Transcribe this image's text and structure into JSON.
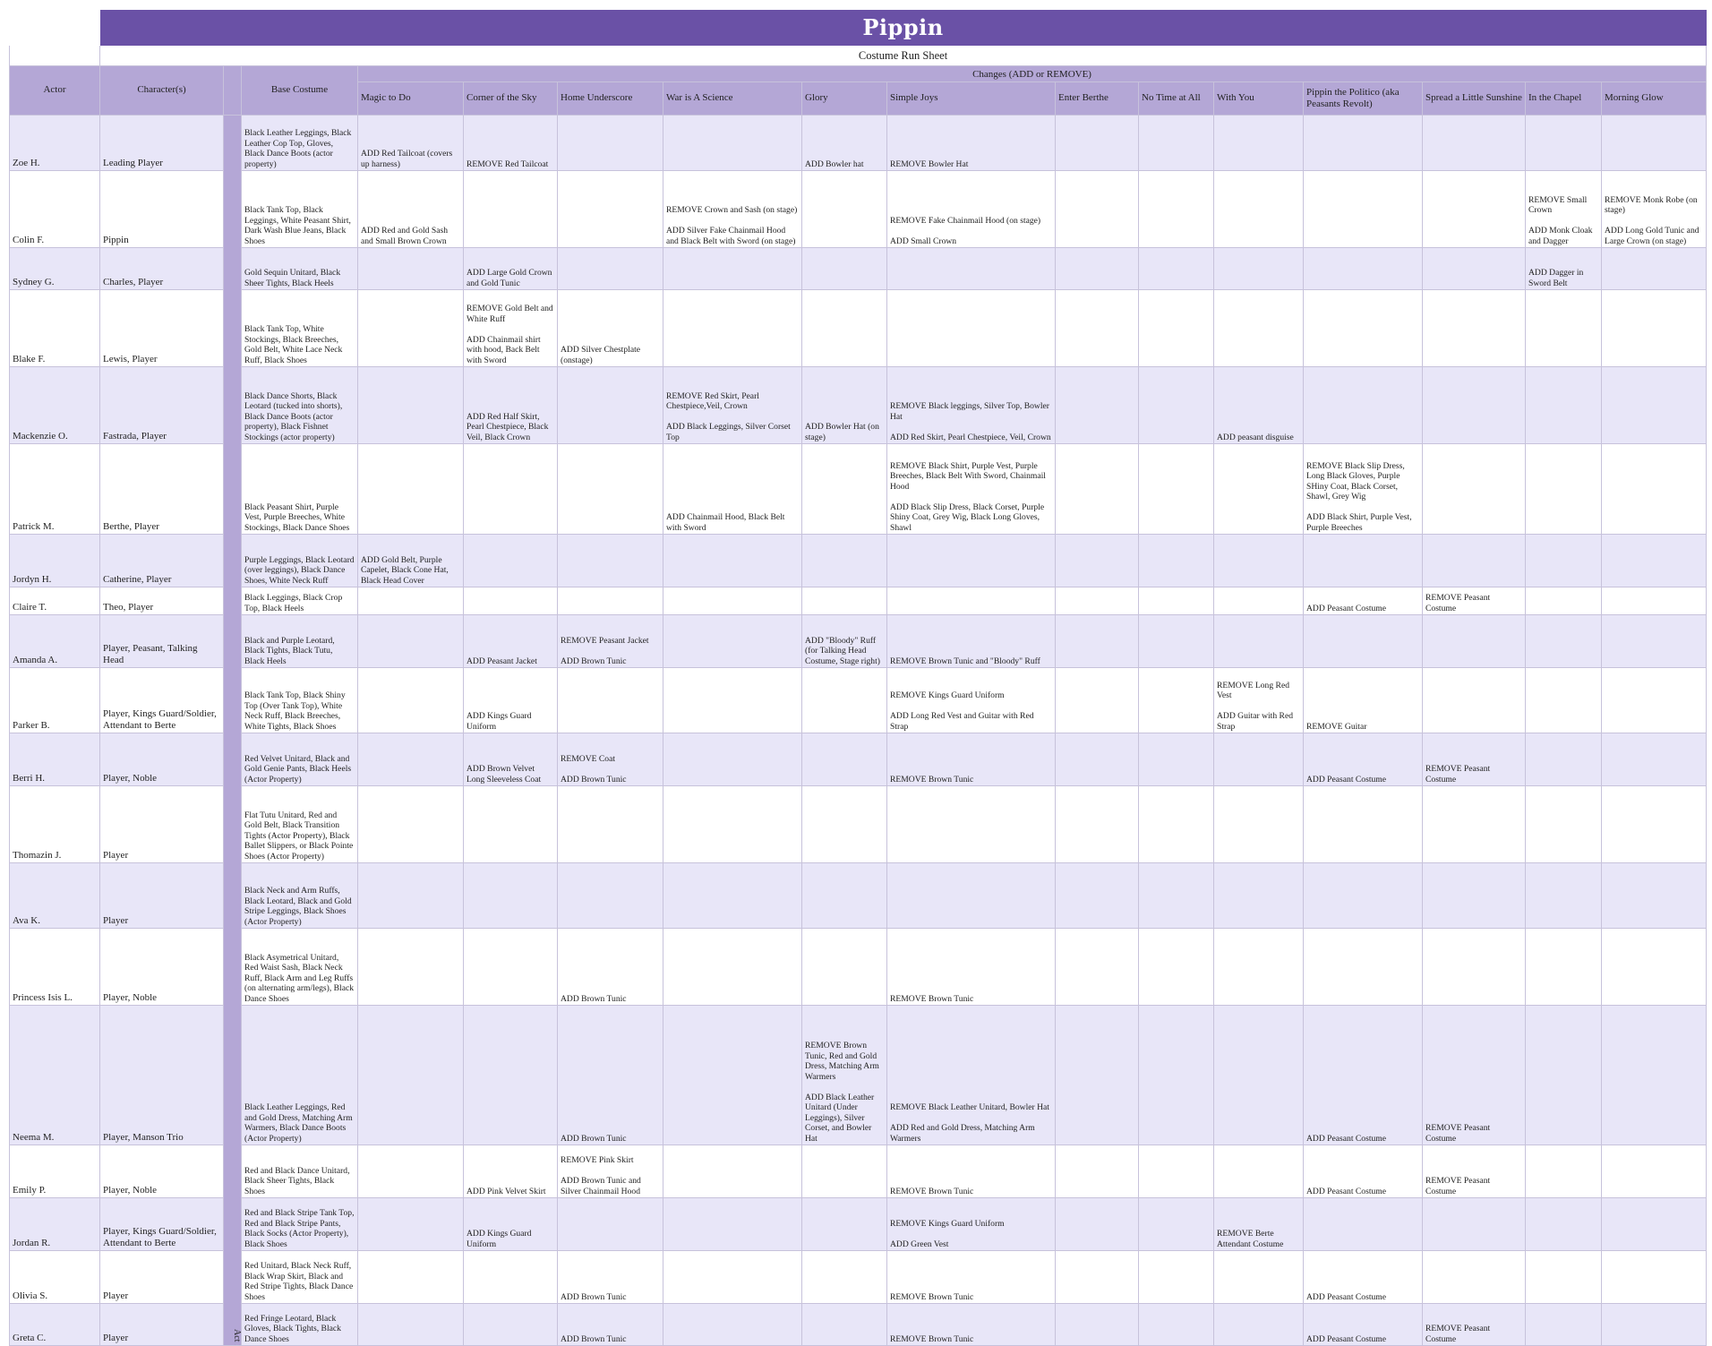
{
  "title": "Pippin",
  "subtitle": "Costume Run Sheet",
  "headers": {
    "actor": "Actor",
    "characters": "Character(s)",
    "base_costume": "Base Costume",
    "changes_group": "Changes (ADD or REMOVE)",
    "songs": [
      "Magic to Do",
      "Corner of the Sky",
      "Home Underscore",
      "War is A Science",
      "Glory",
      "Simple Joys",
      "Enter Berthe",
      "No Time at All",
      "With You",
      "Pippin the Politico (aka Peasants Revolt)",
      "Spread a Little Sunshine",
      "In the Chapel",
      "Morning Glow"
    ]
  },
  "act_label": "Act 1",
  "rows": [
    {
      "actor": "Zoe H.",
      "character": "Leading Player",
      "base": "Black Leather Leggings, Black Leather Cop Top, Gloves, Black Dance Boots (actor property)",
      "changes": [
        "ADD Red Tailcoat (covers up harness)",
        "REMOVE Red Tailcoat",
        "",
        "",
        "ADD Bowler hat",
        "REMOVE Bowler Hat",
        "",
        "",
        "",
        "",
        "",
        "",
        ""
      ]
    },
    {
      "actor": "Colin F.",
      "character": "Pippin",
      "base": "Black Tank Top, Black Leggings, White Peasant Shirt, Dark Wash Blue Jeans, Black Shoes",
      "changes": [
        "ADD Red and Gold Sash and Small Brown Crown",
        "",
        "",
        "REMOVE Crown and Sash (on stage)\n\nADD Silver Fake Chainmail Hood and Black Belt with Sword (on stage)",
        "",
        "REMOVE Fake Chainmail Hood (on stage)\n\nADD Small Crown",
        "",
        "",
        "",
        "",
        "",
        "REMOVE Small Crown\n\nADD Monk Cloak and Dagger",
        "REMOVE Monk Robe (on stage)\n\nADD Long Gold Tunic and Large Crown (on stage)"
      ]
    },
    {
      "actor": "Sydney G.",
      "character": "Charles, Player",
      "base": "Gold Sequin Unitard, Black Sheer Tights, Black Heels",
      "changes": [
        "",
        "ADD Large Gold Crown and Gold Tunic",
        "",
        "",
        "",
        "",
        "",
        "",
        "",
        "",
        "",
        "ADD Dagger in Sword Belt",
        ""
      ]
    },
    {
      "actor": "Blake F.",
      "character": "Lewis, Player",
      "base": "Black Tank Top, White Stockings, Black Breeches, Gold Belt, White Lace Neck Ruff, Black Shoes",
      "changes": [
        "",
        "REMOVE Gold Belt and White Ruff\n\nADD Chainmail shirt with hood, Back Belt with Sword",
        "ADD Silver Chestplate (onstage)",
        "",
        "",
        "",
        "",
        "",
        "",
        "",
        "",
        "",
        ""
      ]
    },
    {
      "actor": "Mackenzie O.",
      "character": "Fastrada, Player",
      "base": "Black Dance Shorts, Black Leotard (tucked into shorts), Black Dance Boots (actor property), Black Fishnet Stockings (actor property)",
      "changes": [
        "",
        "ADD Red Half Skirt, Pearl Chestpiece, Black Veil, Black Crown",
        "",
        "REMOVE Red Skirt, Pearl Chestpiece,Veil, Crown\n\nADD Black Leggings, Silver Corset Top",
        "ADD Bowler Hat (on stage)",
        "REMOVE Black leggings, Silver Top, Bowler Hat\n\nADD Red Skirt, Pearl Chestpiece, Veil, Crown",
        "",
        "",
        "ADD peasant disguise",
        "",
        "",
        "",
        ""
      ]
    },
    {
      "actor": "Patrick M.",
      "character": "Berthe, Player",
      "base": "Black Peasant Shirt, Purple Vest, Purple Breeches, White Stockings, Black Dance Shoes",
      "changes": [
        "",
        "",
        "",
        "ADD Chainmail Hood, Black Belt with Sword",
        "",
        "REMOVE Black Shirt, Purple Vest, Purple Breeches, Black Belt With Sword, Chainmail Hood\n\nADD Black Slip Dress, Black Corset, Purple Shiny Coat, Grey Wig, Black Long Gloves, Shawl",
        "",
        "",
        "",
        "REMOVE Black Slip Dress, Long Black Gloves, Purple SHiny Coat, Black Corset, Shawl, Grey Wig\n\nADD Black Shirt, Purple Vest, Purple Breeches",
        "",
        "",
        ""
      ]
    },
    {
      "actor": "Jordyn H.",
      "character": "Catherine, Player",
      "base": "Purple Leggings, Black Leotard (over leggings), Black Dance Shoes, White Neck Ruff",
      "changes": [
        "ADD Gold Belt, Purple Capelet, Black Cone Hat, Black Head Cover",
        "",
        "",
        "",
        "",
        "",
        "",
        "",
        "",
        "",
        "",
        "",
        ""
      ]
    },
    {
      "actor": "Claire T.",
      "character": "Theo, Player",
      "base": "Black Leggings, Black Crop Top, Black Heels",
      "changes": [
        "",
        "",
        "",
        "",
        "",
        "",
        "",
        "",
        "",
        "ADD Peasant Costume",
        "REMOVE Peasant Costume",
        "",
        ""
      ]
    },
    {
      "actor": "Amanda A.",
      "character": "Player, Peasant, Talking Head",
      "base": "Black and Purple Leotard, Black Tights, Black Tutu, Black Heels",
      "changes": [
        "",
        "ADD Peasant Jacket",
        "REMOVE Peasant Jacket\n\nADD Brown Tunic",
        "",
        "ADD \"Bloody\" Ruff (for Talking Head Costume, Stage right)",
        "REMOVE Brown Tunic and \"Bloody\" Ruff",
        "",
        "",
        "",
        "",
        "",
        "",
        ""
      ]
    },
    {
      "actor": "Parker B.",
      "character": "Player, Kings Guard/Soldier, Attendant to Berte",
      "base": "Black Tank Top, Black Shiny Top (Over Tank Top), White Neck Ruff, Black Breeches, White Tights, Black Shoes",
      "changes": [
        "",
        "ADD Kings Guard Uniform",
        "",
        "",
        "",
        "REMOVE Kings Guard Uniform\n\nADD Long Red Vest and Guitar with Red Strap",
        "",
        "",
        "REMOVE Long Red Vest\n\nADD Guitar with Red Strap",
        "REMOVE Guitar",
        "",
        "",
        ""
      ]
    },
    {
      "actor": "Berri H.",
      "character": "Player, Noble",
      "base": "Red Velvet Unitard, Black and Gold Genie Pants, Black Heels (Actor Property)",
      "changes": [
        "",
        "ADD Brown Velvet Long Sleeveless Coat",
        "REMOVE Coat\n\nADD Brown Tunic",
        "",
        "",
        "REMOVE Brown Tunic",
        "",
        "",
        "",
        "ADD Peasant Costume",
        "REMOVE Peasant Costume",
        "",
        ""
      ]
    },
    {
      "actor": "Thomazin J.",
      "character": "Player",
      "base": "Flat Tutu Unitard, Red and Gold Belt, Black Transition Tights (Actor Property), Black Ballet Slippers, or Black Pointe Shoes (Actor Property)",
      "changes": [
        "",
        "",
        "",
        "",
        "",
        "",
        "",
        "",
        "",
        "",
        "",
        "",
        ""
      ]
    },
    {
      "actor": "Ava K.",
      "character": "Player",
      "base": "Black Neck and Arm Ruffs, Black Leotard, Black and Gold Stripe Leggings, Black Shoes (Actor Property)",
      "changes": [
        "",
        "",
        "",
        "",
        "",
        "",
        "",
        "",
        "",
        "",
        "",
        "",
        ""
      ]
    },
    {
      "actor": "Princess Isis L.",
      "character": "Player, Noble",
      "base": "Black Asymetrical Unitard, Red Waist Sash, Black Neck Ruff, Black Arm and Leg Ruffs (on alternating arm/legs), Black Dance Shoes",
      "changes": [
        "",
        "",
        "ADD Brown Tunic",
        "",
        "",
        "REMOVE Brown Tunic",
        "",
        "",
        "",
        "",
        "",
        "",
        ""
      ]
    },
    {
      "actor": "Neema M.",
      "character": "Player, Manson Trio",
      "base": "Black Leather Leggings, Red and Gold Dress, Matching Arm Warmers, Black Dance Boots (Actor Property)",
      "changes": [
        "",
        "",
        "ADD Brown Tunic",
        "",
        "REMOVE Brown Tunic, Red and Gold Dress, Matching Arm Warmers\n\nADD Black Leather Unitard (Under Leggings), Silver Corset, and Bowler Hat",
        "REMOVE Black Leather Unitard, Bowler Hat\n\nADD Red and Gold Dress, Matching Arm Warmers",
        "",
        "",
        "",
        "ADD Peasant Costume",
        "REMOVE Peasant Costume",
        "",
        ""
      ]
    },
    {
      "actor": "Emily P.",
      "character": "Player, Noble",
      "base": "Red and Black Dance Unitard, Black Sheer Tights, Black Shoes",
      "changes": [
        "",
        "ADD Pink Velvet Skirt",
        "REMOVE Pink Skirt\n\nADD Brown Tunic and Silver Chainmail Hood",
        "",
        "",
        "REMOVE Brown Tunic",
        "",
        "",
        "",
        "ADD Peasant Costume",
        "REMOVE Peasant Costume",
        "",
        ""
      ]
    },
    {
      "actor": "Jordan R.",
      "character": "Player, Kings Guard/Soldier, Attendant to Berte",
      "base": "Red and Black Stripe Tank Top, Red and Black Stripe Pants, Black Socks (Actor Property), Black Shoes",
      "changes": [
        "",
        "ADD Kings Guard Uniform",
        "",
        "",
        "",
        "REMOVE Kings Guard Uniform\n\nADD Green Vest",
        "",
        "",
        "REMOVE Berte Attendant Costume",
        "",
        "",
        "",
        ""
      ]
    },
    {
      "actor": "Olivia S.",
      "character": "Player",
      "base": "Red Unitard, Black Neck Ruff, Black Wrap Skirt, Black and Red Stripe Tights, Black Dance Shoes",
      "changes": [
        "",
        "",
        "ADD Brown Tunic",
        "",
        "",
        "REMOVE Brown Tunic",
        "",
        "",
        "",
        "ADD Peasant Costume",
        "",
        "",
        ""
      ]
    },
    {
      "actor": "Greta C.",
      "character": "Player",
      "base": "Red Fringe Leotard, Black Gloves, Black Tights, Black Dance Shoes",
      "changes": [
        "",
        "",
        "ADD Brown Tunic",
        "",
        "",
        "REMOVE Brown Tunic",
        "",
        "",
        "",
        "ADD Peasant Costume",
        "REMOVE Peasant Costume",
        "",
        ""
      ]
    }
  ],
  "colors": {
    "title_bar": "#6a51a6",
    "header": "#b4a7d6",
    "row_alt": "#e8e6f8",
    "row": "#ffffff"
  }
}
